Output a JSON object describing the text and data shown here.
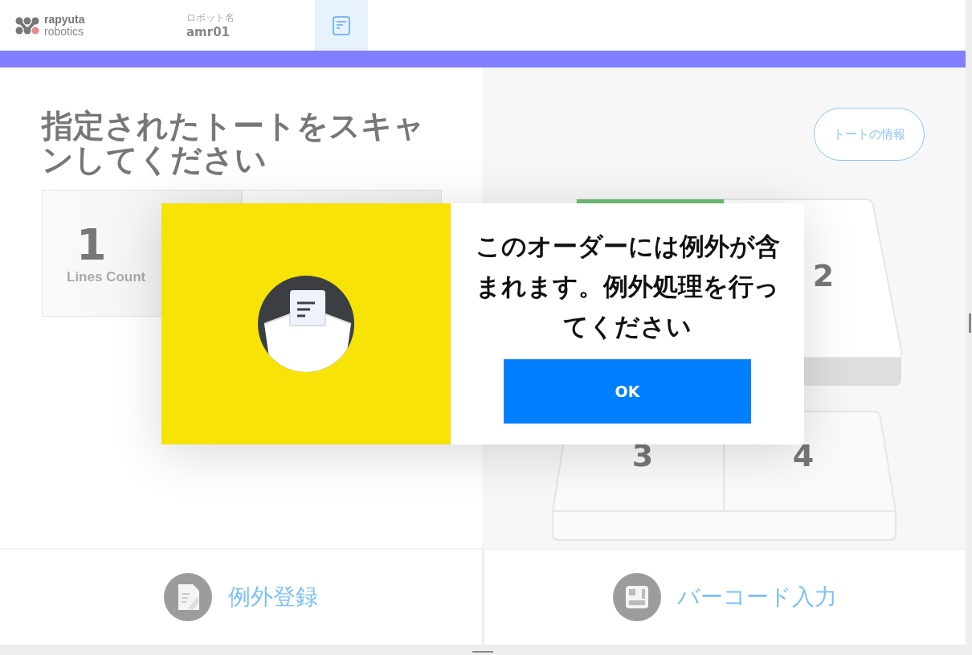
{
  "header": {
    "logo": {
      "line1": "rapyuta",
      "line2": "robotics"
    },
    "robot_label": "ロボット名",
    "robot_name": "amr01",
    "tab": {
      "selected": true
    }
  },
  "title": "指定されたトートをスキャンしてください",
  "tote_info_button": "トートの情報",
  "stats": [
    {
      "value": "1",
      "label": "Lines Count"
    }
  ],
  "tote": {
    "compartments": [
      {
        "highlighted": true
      },
      {
        "number": "2",
        "highlighted": false
      },
      {
        "number": "3",
        "highlighted": false
      },
      {
        "number": "4",
        "highlighted": false
      }
    ]
  },
  "dialog": {
    "message": "このオーダーには例外が含まれます。例外処理を行ってください",
    "ok_button": "OK"
  },
  "actions": [
    {
      "kind": "exception",
      "label": "例外登録"
    },
    {
      "kind": "barcode",
      "label": "バーコード入力"
    }
  ]
}
